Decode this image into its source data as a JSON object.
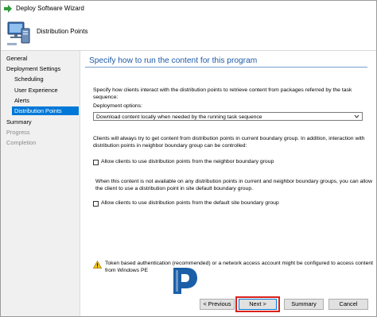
{
  "window": {
    "title": "Deploy Software Wizard"
  },
  "header": {
    "title": "Distribution Points"
  },
  "nav": {
    "items": [
      {
        "label": "General",
        "state": "normal"
      },
      {
        "label": "Deployment Settings",
        "state": "normal"
      },
      {
        "label": "Scheduling",
        "state": "normal"
      },
      {
        "label": "User Experience",
        "state": "normal"
      },
      {
        "label": "Alerts",
        "state": "normal"
      },
      {
        "label": "Distribution Points",
        "state": "selected"
      },
      {
        "label": "Summary",
        "state": "normal"
      },
      {
        "label": "Progress",
        "state": "disabled"
      },
      {
        "label": "Completion",
        "state": "disabled"
      }
    ]
  },
  "main": {
    "page_title": "Specify how to run the content for this program",
    "intro_line1": "Specify how clients interact with the distribution points to retrieve content from packages referred by the task",
    "intro_line2": "sequence:",
    "deployment_options_label": "Deployment options:",
    "deployment_options_value": "Download content locally when needed by the running task sequence",
    "neighbor_text_line1": "Clients will always try to get content from distribution points in current boundary group. In addition, interaction with",
    "neighbor_text_line2": "distribution points in neighbor boundary group can be controlled:",
    "neighbor_checkbox_label": "Allow clients to use distribution points from the neighbor boundary group",
    "neighbor_checked": false,
    "default_text_line1": "When this content is not available on any distribution points in current and neighbor boundary groups, you can allow",
    "default_text_line2": "the client to use a distribution point in site default boundary group.",
    "default_checkbox_label": "Allow clients to use distribution points from the default site boundary group",
    "default_checked": false,
    "warning_line1": "Token based authentication (recommended) or a network access account might be configured to access content",
    "warning_line2": "from Windows PE"
  },
  "buttons": {
    "previous": "< Previous",
    "next": "Next >",
    "summary": "Summary",
    "cancel": "Cancel"
  },
  "colors": {
    "accent": "#0078d7",
    "title_blue": "#1e5aa8",
    "highlight_red": "#d9201a",
    "logo_blue": "#1a5fa8"
  },
  "icons": {
    "app": "deploy-arrow-icon",
    "header": "computer-icon",
    "warning": "warning-icon",
    "logo": "p-logo-icon"
  }
}
